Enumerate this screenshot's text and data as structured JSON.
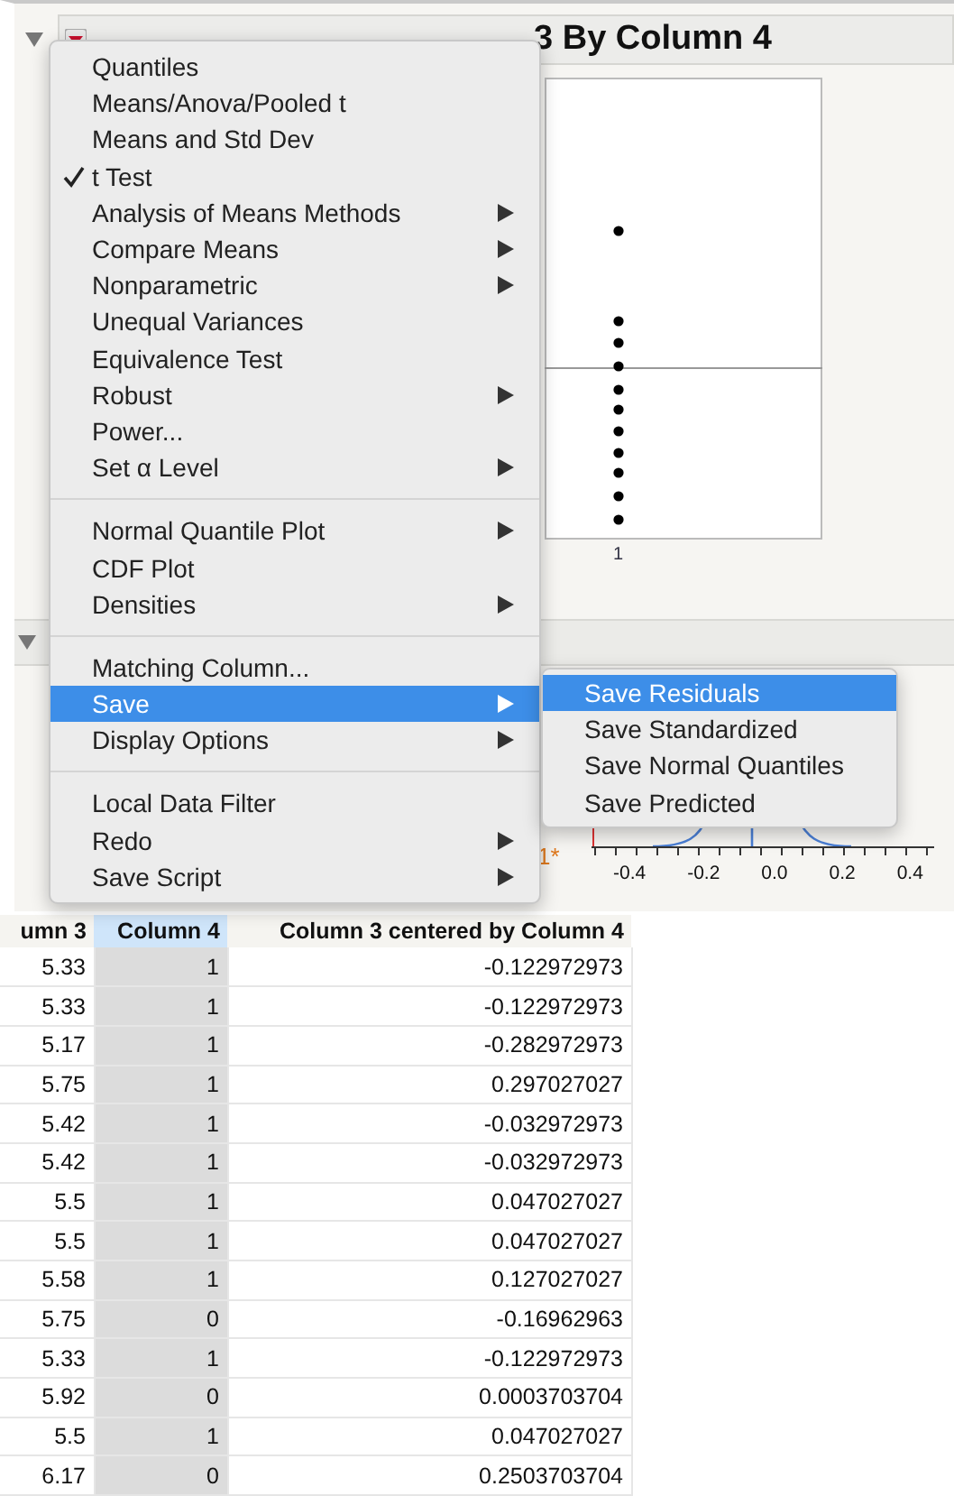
{
  "report": {
    "title": "3 By Column 4",
    "expanded": true,
    "x_label": "1"
  },
  "lower_panel": {
    "row_labels": [
      {
        "text": "1*",
        "kind": "flagged"
      }
    ],
    "axis_labels": [
      "-0.4",
      "-0.2",
      "0.0",
      "0.2",
      "0.4"
    ]
  },
  "menu": {
    "groups": [
      [
        {
          "label": "Quantiles",
          "checked": false,
          "submenu": false,
          "selected": false
        },
        {
          "label": "Means/Anova/Pooled t",
          "checked": false,
          "submenu": false,
          "selected": false
        },
        {
          "label": "Means and Std Dev",
          "checked": false,
          "submenu": false,
          "selected": false
        },
        {
          "label": "t Test",
          "checked": true,
          "submenu": false,
          "selected": false
        },
        {
          "label": "Analysis of Means Methods",
          "checked": false,
          "submenu": true,
          "selected": false
        },
        {
          "label": "Compare Means",
          "checked": false,
          "submenu": true,
          "selected": false
        },
        {
          "label": "Nonparametric",
          "checked": false,
          "submenu": true,
          "selected": false
        },
        {
          "label": "Unequal Variances",
          "checked": false,
          "submenu": false,
          "selected": false
        },
        {
          "label": "Equivalence Test",
          "checked": false,
          "submenu": false,
          "selected": false
        },
        {
          "label": "Robust",
          "checked": false,
          "submenu": true,
          "selected": false
        },
        {
          "label": "Power...",
          "checked": false,
          "submenu": false,
          "selected": false
        },
        {
          "label": "Set α Level",
          "checked": false,
          "submenu": true,
          "selected": false
        }
      ],
      [
        {
          "label": "Normal Quantile Plot",
          "checked": false,
          "submenu": true,
          "selected": false
        },
        {
          "label": "CDF Plot",
          "checked": false,
          "submenu": false,
          "selected": false
        },
        {
          "label": "Densities",
          "checked": false,
          "submenu": true,
          "selected": false
        }
      ],
      [
        {
          "label": "Matching Column...",
          "checked": false,
          "submenu": false,
          "selected": false
        },
        {
          "label": "Save",
          "checked": false,
          "submenu": true,
          "selected": true
        },
        {
          "label": "Display Options",
          "checked": false,
          "submenu": true,
          "selected": false
        }
      ],
      [
        {
          "label": "Local Data Filter",
          "checked": false,
          "submenu": false,
          "selected": false
        },
        {
          "label": "Redo",
          "checked": false,
          "submenu": true,
          "selected": false
        },
        {
          "label": "Save Script",
          "checked": false,
          "submenu": true,
          "selected": false
        }
      ]
    ]
  },
  "submenu": {
    "items": [
      {
        "label": "Save Residuals",
        "selected": true
      },
      {
        "label": "Save Standardized",
        "selected": false
      },
      {
        "label": "Save Normal Quantiles",
        "selected": false
      },
      {
        "label": "Save Predicted",
        "selected": false
      }
    ]
  },
  "table": {
    "columns": [
      {
        "label": "umn 3",
        "selected": false
      },
      {
        "label": "Column 4",
        "selected": true
      },
      {
        "label": "Column 3 centered by Column 4",
        "selected": false
      }
    ],
    "rows": [
      [
        "5.33",
        "1",
        "-0.122972973"
      ],
      [
        "5.33",
        "1",
        "-0.122972973"
      ],
      [
        "5.17",
        "1",
        "-0.282972973"
      ],
      [
        "5.75",
        "1",
        "0.297027027"
      ],
      [
        "5.42",
        "1",
        "-0.032972973"
      ],
      [
        "5.42",
        "1",
        "-0.032972973"
      ],
      [
        "5.5",
        "1",
        "0.047027027"
      ],
      [
        "5.5",
        "1",
        "0.047027027"
      ],
      [
        "5.58",
        "1",
        "0.127027027"
      ],
      [
        "5.75",
        "0",
        "-0.16962963"
      ],
      [
        "5.33",
        "1",
        "-0.122972973"
      ],
      [
        "5.92",
        "0",
        "0.0003703704"
      ],
      [
        "5.5",
        "1",
        "0.047027027"
      ],
      [
        "6.17",
        "0",
        "0.2503703704"
      ]
    ]
  }
}
